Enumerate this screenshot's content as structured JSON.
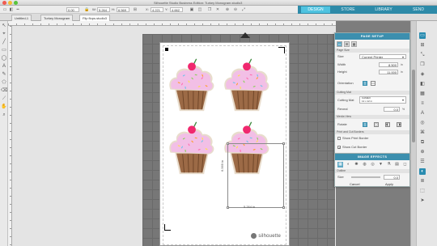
{
  "window": {
    "title": "Silhouette Studio Business Edition: Turkey Monogram.studio3"
  },
  "topnav": {
    "tabs": [
      {
        "label": "DESIGN",
        "active": true
      },
      {
        "label": "STORE",
        "active": false
      },
      {
        "label": "LIBRARY",
        "active": false
      },
      {
        "label": "SEND",
        "active": false
      }
    ]
  },
  "toolbar": {
    "line_width": "0.00",
    "width_label": "W:",
    "width_value": "5.264",
    "height_label": "H:",
    "height_value": "6.569",
    "x_label": "X:",
    "x_value": "4.221",
    "y_label": "Y:",
    "y_value": "4.662"
  },
  "doctabs": [
    {
      "label": "Untitled-1",
      "active": false
    },
    {
      "label": "Turkey Monogram",
      "active": false
    },
    {
      "label": "Flip flops.studio3",
      "active": true
    }
  ],
  "canvas": {
    "brand": "silhouette",
    "dimension_width": "5.264 in",
    "dimension_height": "6.569 in"
  },
  "page_setup": {
    "title": "PAGE SETUP",
    "sections": {
      "page_size": "Page Size",
      "cutting_mat": "Cutting Mat",
      "media_view": "Media View",
      "print_cut": "Print and Cut Borders"
    },
    "size_label": "Size",
    "size_value": "Current Printer",
    "width_label": "Width",
    "width_value": "8.500",
    "height_label": "Height",
    "height_value": "11.000",
    "unit": "in",
    "orientation_label": "Orientation",
    "cutting_mat_label": "Cutting Mat",
    "cutting_mat_value": "CAMEO\n12 x 12 in",
    "reveal_label": "Reveal",
    "reveal_value": "0.0",
    "reveal_unit": "%",
    "rotate_label": "Rotate",
    "show_print_border": "Show Print Border",
    "show_cut_border": "Show Cut Border",
    "show_print_border_checked": false,
    "show_cut_border_checked": true
  },
  "image_effects": {
    "title": "IMAGE EFFECTS",
    "section": "Outline",
    "size_label": "Size",
    "size_value": "0.0",
    "cancel_label": "Cancel",
    "apply_label": "Apply"
  },
  "colors": {
    "accent": "#3c8fae",
    "nav_bg": "#2d8aa8",
    "frosting": "#f2bfe6",
    "wrapper": "#9c6a46",
    "cherry": "#f0286e"
  }
}
